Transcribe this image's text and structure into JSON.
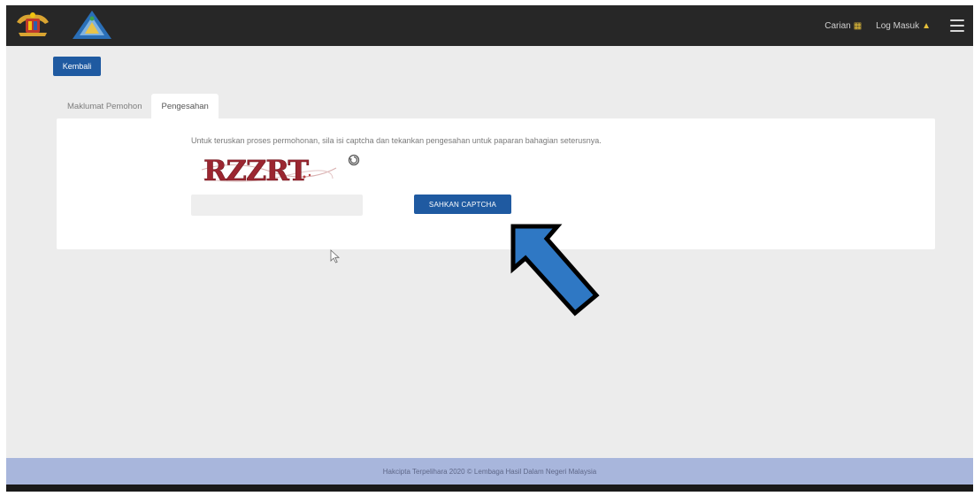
{
  "header": {
    "nav": [
      {
        "label": "Carian",
        "icon": "search-icon"
      },
      {
        "label": "Log Masuk",
        "icon": "lock-icon"
      }
    ],
    "menu_icon": "hamburger-menu-icon"
  },
  "back_button": {
    "label": "Kembali"
  },
  "tabs": [
    {
      "label": "Maklumat Pemohon",
      "active": false
    },
    {
      "label": "Pengesahan",
      "active": true
    }
  ],
  "verification": {
    "instruction": "Untuk teruskan proses permohonan, sila isi captcha dan tekankan pengesahan untuk paparan bahagian seterusnya.",
    "captcha_text": "RZZRT",
    "input_placeholder": "",
    "submit_label": "SAHKAN CAPTCHA"
  },
  "footer": {
    "text": "Hakcipta Terpelihara 2020 © Lembaga Hasil Dalam Negeri Malaysia"
  },
  "colors": {
    "primary": "#1f5aa1",
    "topbar": "#272727",
    "footer": "#a8b6dc",
    "annotation_arrow": "#2f78c4"
  }
}
